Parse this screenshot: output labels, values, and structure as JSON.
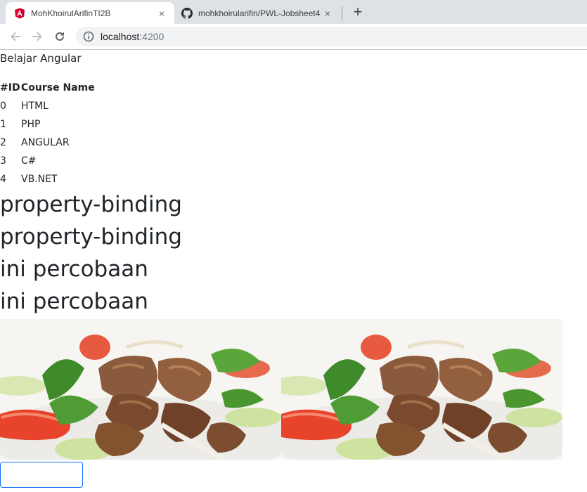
{
  "browser": {
    "tabs": [
      {
        "title": "MohKhoirulArifinTI2B",
        "icon": "angular-icon",
        "active": true
      },
      {
        "title": "mohkhoirularifin/PWL-Jobsheet4",
        "icon": "github-icon",
        "active": false
      }
    ],
    "new_tab_label": "+",
    "close_glyph": "×",
    "url_host": "localhost",
    "url_port": ":4200",
    "nav_icons": [
      "back-arrow-icon",
      "forward-arrow-icon",
      "reload-icon",
      "info-icon"
    ]
  },
  "page": {
    "title": "Belajar Angular",
    "table": {
      "headers": [
        "#ID",
        "Course Name"
      ],
      "rows": [
        {
          "id": "0",
          "name": "HTML"
        },
        {
          "id": "1",
          "name": "PHP"
        },
        {
          "id": "2",
          "name": "ANGULAR"
        },
        {
          "id": "3",
          "name": "C#"
        },
        {
          "id": "4",
          "name": "VB.NET"
        }
      ]
    },
    "headings": [
      "property-binding",
      "property-binding",
      "ini percobaan",
      "ini percobaan"
    ],
    "images": [
      {
        "subject": "beef salad with tomato and cucumber"
      },
      {
        "subject": "beef salad with tomato and cucumber"
      }
    ],
    "input": {
      "value": "",
      "border_color": "#0d6efd"
    }
  },
  "colors": {
    "tabstrip_bg": "#dee1e6",
    "omnibox_bg": "#f1f3f4",
    "angular_red": "#dd0031",
    "text": "#212529"
  }
}
